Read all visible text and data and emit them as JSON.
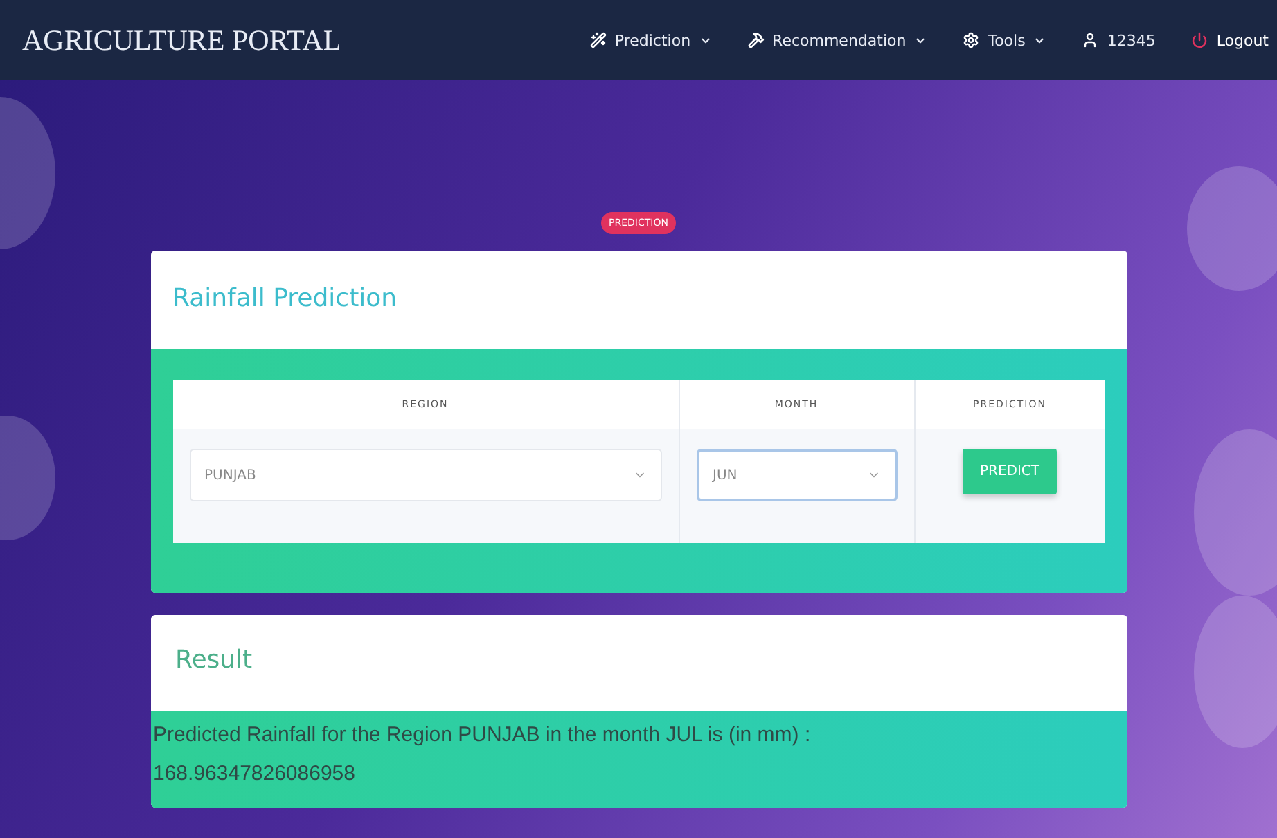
{
  "navbar": {
    "brand": "AGRICULTURE PORTAL",
    "items": [
      {
        "kind": "dropdown",
        "label": "Prediction"
      },
      {
        "kind": "dropdown",
        "label": "Recommendation"
      },
      {
        "kind": "dropdown",
        "label": "Tools"
      },
      {
        "kind": "link",
        "label": "12345"
      },
      {
        "kind": "logout",
        "label": "Logout"
      }
    ]
  },
  "badge": "PREDICTION",
  "form_card": {
    "title": "Rainfall Prediction",
    "columns": [
      "REGION",
      "MONTH",
      "PREDICTION"
    ],
    "fields": [
      {
        "value": "PUNJAB",
        "focused": false
      },
      {
        "value": "JUN",
        "focused": true
      }
    ],
    "button": "PREDICT"
  },
  "result_card": {
    "title": "Result",
    "text": "Predicted Rainfall for the Region PUNJAB in the month JUL is (in mm) :",
    "value": "168.96347826086958"
  }
}
